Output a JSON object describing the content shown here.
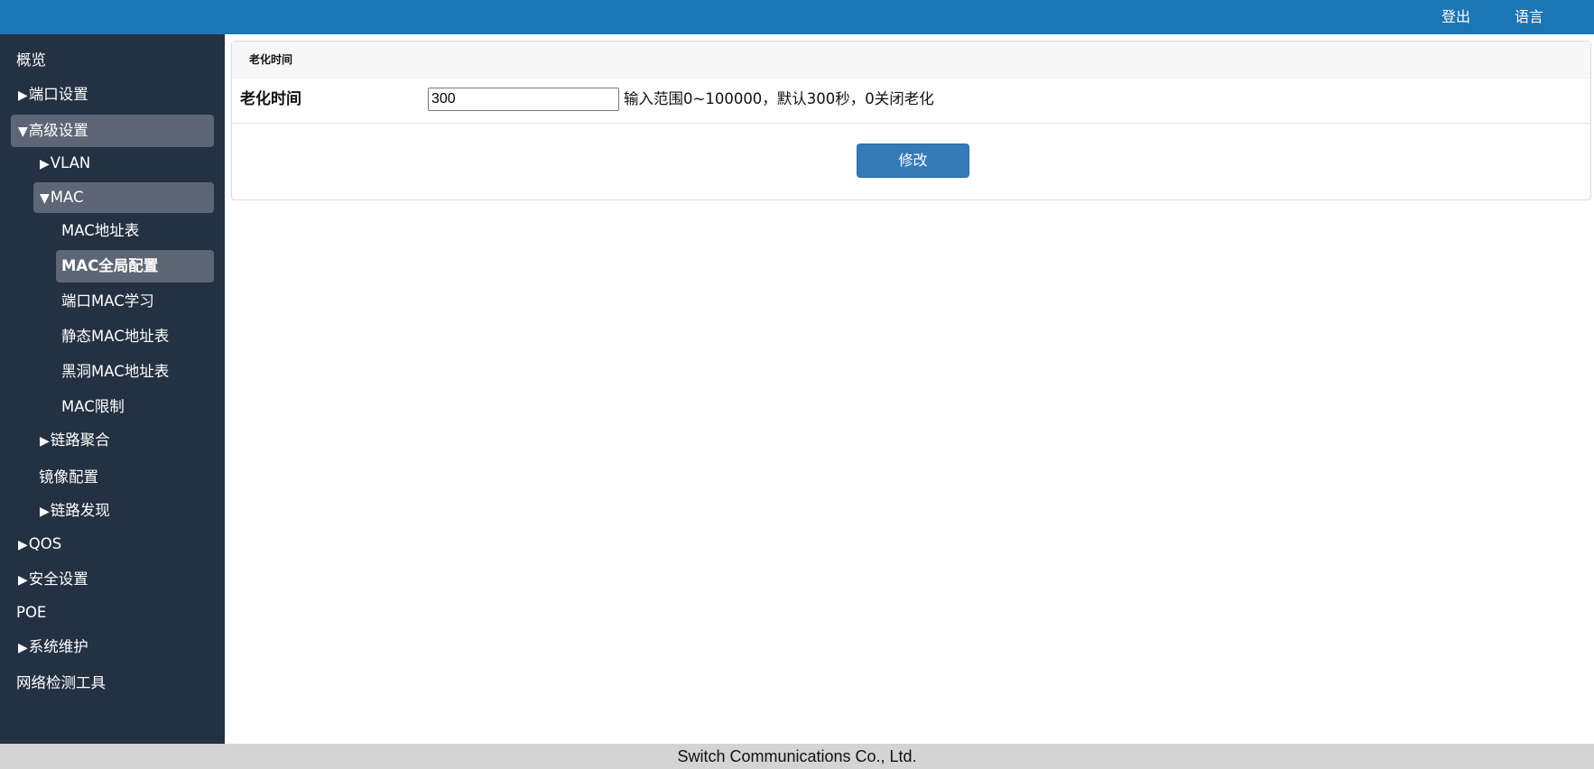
{
  "header": {
    "logout_label": "登出",
    "language_label": "语言"
  },
  "sidebar": {
    "overview": "概览",
    "port_settings": "端口设置",
    "advanced_settings": "高级设置",
    "vlan": "VLAN",
    "mac": "MAC",
    "mac_address_table": "MAC地址表",
    "mac_global_config": "MAC全局配置",
    "port_mac_learning": "端口MAC学习",
    "static_mac_table": "静态MAC地址表",
    "blackhole_mac_table": "黑洞MAC地址表",
    "mac_limit": "MAC限制",
    "link_aggregation": "链路聚合",
    "mirror_config": "镜像配置",
    "link_discovery": "链路发现",
    "qos": "QOS",
    "security_settings": "安全设置",
    "poe": "POE",
    "system_maintenance": "系统维护",
    "network_tools": "网络检测工具",
    "caret_collapsed": "▶",
    "caret_expanded": "▼"
  },
  "panel": {
    "title": "老化时间",
    "field_label": "老化时间",
    "age_value": "300",
    "hint": "输入范围0~100000，默认300秒，0关闭老化",
    "submit_label": "修改"
  },
  "footer": {
    "text": "Switch Communications Co., Ltd."
  },
  "colors": {
    "header_bg": "#1c75b5",
    "sidebar_bg": "#233142",
    "active_item_bg": "#5c6675",
    "button_bg": "#337ab7",
    "footer_bg": "#d4d4d4"
  }
}
